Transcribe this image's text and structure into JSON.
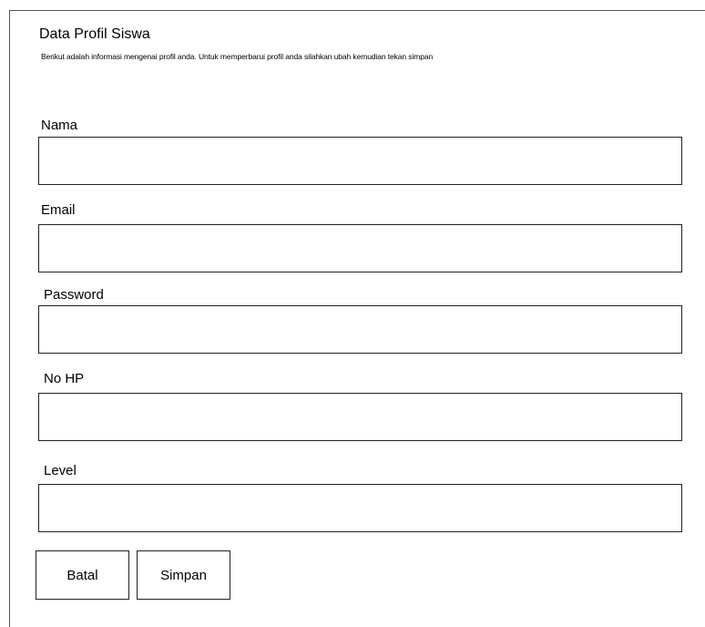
{
  "header": {
    "title": "Data Profil Siswa",
    "subtitle": "Berikut adalah informasi mengenai profil anda. Untuk memperbarui profil anda silahkan ubah kemudian tekan simpan"
  },
  "form": {
    "nama_label": "Nama",
    "nama_value": "",
    "email_label": "Email",
    "email_value": "",
    "password_label": "Password",
    "password_value": "",
    "nohp_label": "No HP",
    "nohp_value": "",
    "level_label": "Level",
    "level_value": ""
  },
  "actions": {
    "cancel_label": "Batal",
    "save_label": "Simpan"
  }
}
